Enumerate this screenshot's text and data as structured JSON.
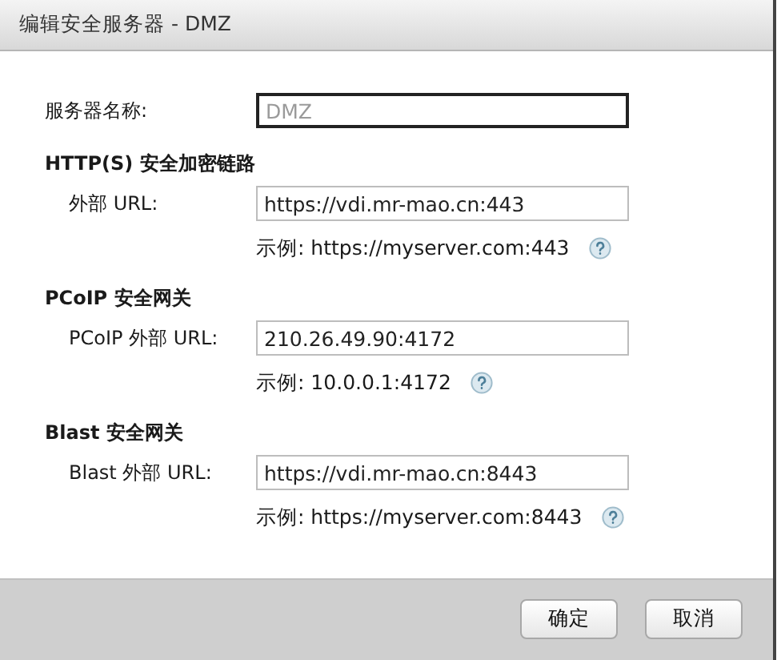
{
  "window": {
    "title": "编辑安全服务器 - DMZ"
  },
  "server_name": {
    "label": "服务器名称:",
    "value": "DMZ",
    "disabled": true
  },
  "sections": [
    {
      "title": "HTTP(S) 安全加密链路",
      "label": "外部 URL:",
      "value": "https://vdi.mr-mao.cn:443",
      "example": "示例: https://myserver.com:443"
    },
    {
      "title": "PCoIP 安全网关",
      "label": "PCoIP 外部 URL:",
      "value": "210.26.49.90:4172",
      "example": "示例: 10.0.0.1:4172"
    },
    {
      "title": "Blast 安全网关",
      "label": "Blast 外部 URL:",
      "value": "https://vdi.mr-mao.cn:8443",
      "example": "示例: https://myserver.com:8443"
    }
  ],
  "buttons": [
    "确定",
    "取消"
  ]
}
